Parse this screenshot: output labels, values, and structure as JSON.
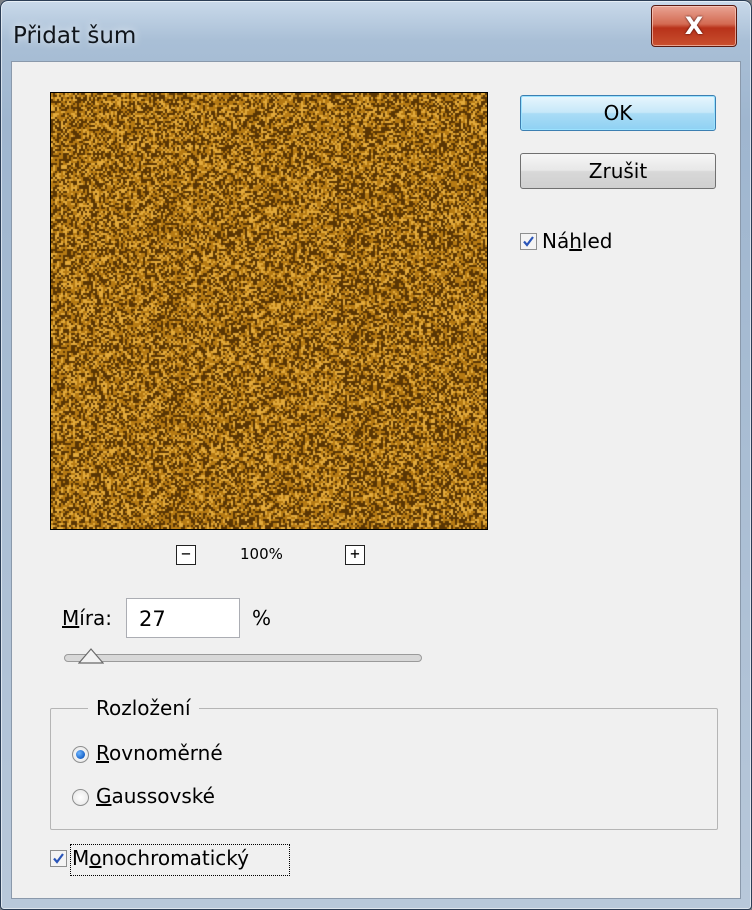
{
  "window": {
    "title": "Přidat šum",
    "close_glyph": "X"
  },
  "preview": {
    "zoom_level": "100%",
    "zoom_out_glyph": "−",
    "zoom_in_glyph": "+",
    "noise_colors": [
      "#b57a14",
      "#5a3604",
      "#e2a93a"
    ]
  },
  "buttons": {
    "ok": "OK",
    "cancel": "Zrušit"
  },
  "preview_toggle": {
    "label_pre": "Ná",
    "label_accel": "h",
    "label_post": "led",
    "checked": true
  },
  "amount": {
    "label_accel": "M",
    "label_rest": "íra:",
    "value": "27",
    "unit": "%",
    "level_percent": 27
  },
  "distribution": {
    "legend": "Rozložení",
    "options": [
      {
        "accel": "R",
        "rest": "ovnoměrné",
        "selected": true
      },
      {
        "accel": "G",
        "rest": "aussovské",
        "selected": false
      }
    ]
  },
  "monochromatic": {
    "label_pre": "M",
    "label_accel": "o",
    "label_post": "nochromatický",
    "checked": true
  }
}
